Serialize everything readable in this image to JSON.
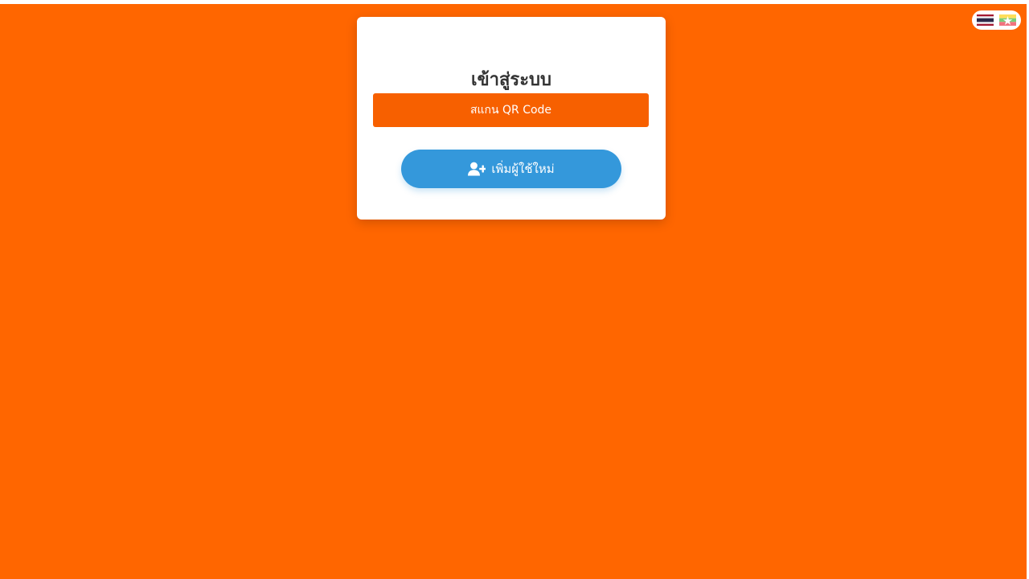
{
  "login": {
    "title": "เข้าสู่ระบบ",
    "scan_qr_label": "สแกน QR Code",
    "add_user_label": "เพิ่มผู้ใช้ใหม่"
  },
  "language_switcher": {
    "options": [
      {
        "icon": "thailand-flag-icon"
      },
      {
        "icon": "myanmar-flag-icon"
      }
    ]
  },
  "colors": {
    "background": "#ff6600",
    "primary_orange": "#f76000",
    "add_user_blue": "#3498db",
    "card": "#ffffff",
    "title_text": "#333333"
  }
}
